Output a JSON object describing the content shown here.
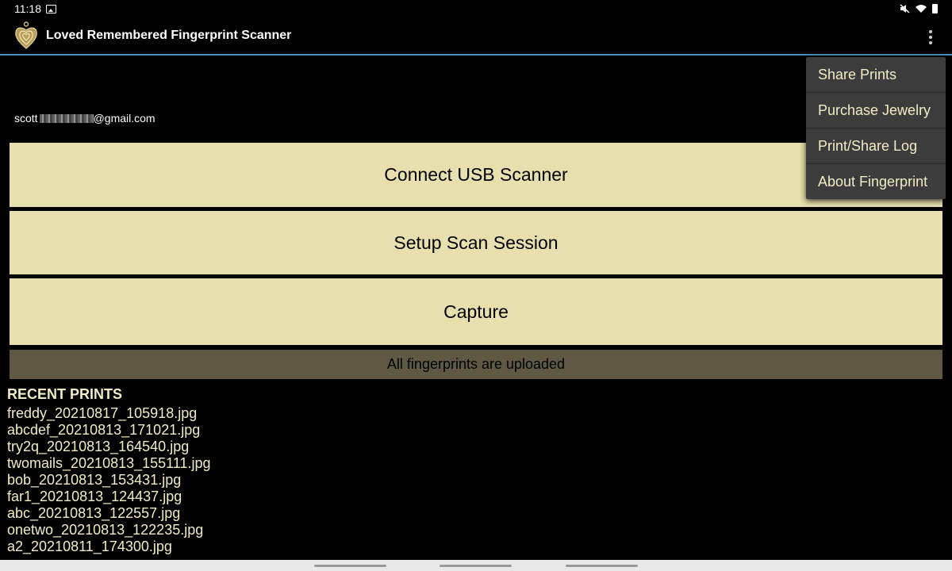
{
  "status_bar": {
    "time": "11:18",
    "left_icons": [
      "image-icon"
    ],
    "right_icons": [
      "mute-icon",
      "wifi-icon",
      "battery-icon"
    ]
  },
  "app_bar": {
    "title": "Loved Remembered Fingerprint Scanner",
    "logo_icon": "heart-fingerprint-pendant-icon",
    "menu_icon": "overflow-menu-icon",
    "accent_color": "#4a90b6"
  },
  "account": {
    "email_prefix": "scott",
    "email_suffix": "@gmail.com"
  },
  "buttons": {
    "connect": "Connect USB Scanner",
    "setup": "Setup Scan Session",
    "capture": "Capture",
    "color": "#e8dfae"
  },
  "upload_status": {
    "text": "All fingerprints are uploaded",
    "color": "#5f5944"
  },
  "recent": {
    "header": "RECENT PRINTS",
    "items": [
      "freddy_20210817_105918.jpg",
      "abcdef_20210813_171021.jpg",
      "try2q_20210813_164540.jpg",
      "twomails_20210813_155111.jpg",
      "bob_20210813_153431.jpg",
      "far1_20210813_124437.jpg",
      "abc_20210813_122557.jpg",
      "onetwo_20210813_122235.jpg",
      "a2_20210811_174300.jpg"
    ]
  },
  "overflow_menu": {
    "items": [
      "Share Prints",
      "Purchase Jewelry",
      "Print/Share Log",
      "About Fingerprint"
    ]
  }
}
